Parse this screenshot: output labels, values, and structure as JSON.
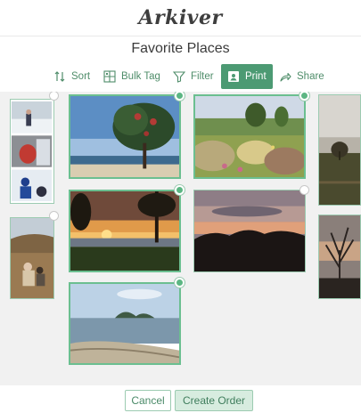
{
  "app": {
    "logo": "Arkiver"
  },
  "album": {
    "title": "Favorite Places"
  },
  "toolbar": {
    "sort": "Sort",
    "bulk_tag": "Bulk Tag",
    "filter": "Filter",
    "print": "Print",
    "share": "Share",
    "accent": "#4c9a73"
  },
  "photos": [
    {
      "name": "collage-snow-family",
      "selected": false
    },
    {
      "name": "pohutukawa-tree-beach",
      "selected": true
    },
    {
      "name": "garden-flowers-hills",
      "selected": true
    },
    {
      "name": "misty-field-tree",
      "selected": false
    },
    {
      "name": "sunset-over-sea",
      "selected": true
    },
    {
      "name": "dusk-treeline",
      "selected": false
    },
    {
      "name": "rocky-hill-people",
      "selected": false
    },
    {
      "name": "bare-tree-sunset",
      "selected": false
    },
    {
      "name": "bay-island-beach",
      "selected": true
    }
  ],
  "footer": {
    "cancel": "Cancel",
    "create_order": "Create Order"
  }
}
